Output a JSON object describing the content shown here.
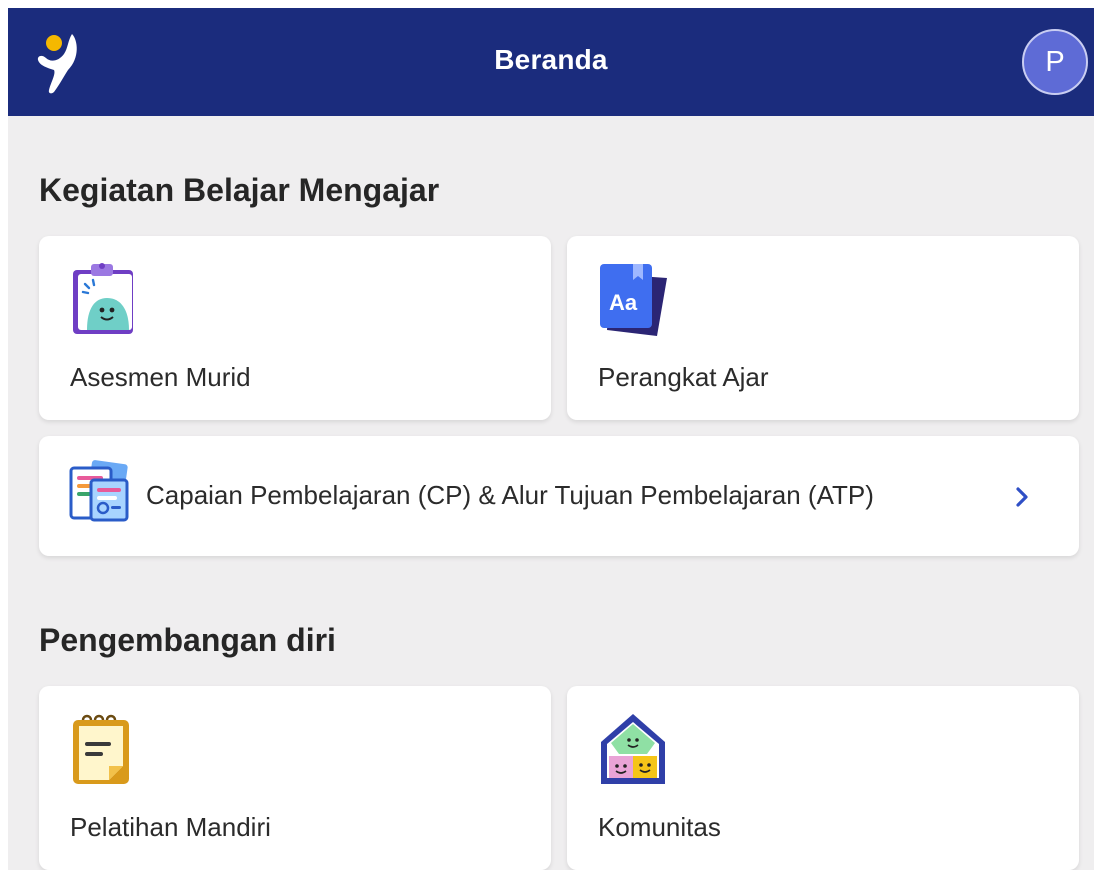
{
  "header": {
    "title": "Beranda",
    "avatar_initial": "P",
    "logo_icon": "app-logo-icon"
  },
  "sections": [
    {
      "title": "Kegiatan Belajar Mengajar",
      "cards": [
        {
          "label": "Asesmen Murid",
          "icon": "clipboard-smiley-icon"
        },
        {
          "label": "Perangkat Ajar",
          "icon": "book-aa-icon"
        },
        {
          "label": "Capaian Pembelajaran (CP) & Alur Tujuan Pembelajaran (ATP)",
          "icon": "documents-stack-icon",
          "trailing_icon": "chevron-right-icon"
        }
      ]
    },
    {
      "title": "Pengembangan diri",
      "cards": [
        {
          "label": "Pelatihan Mandiri",
          "icon": "notepad-icon"
        },
        {
          "label": "Komunitas",
          "icon": "community-house-icon"
        }
      ]
    }
  ],
  "colors": {
    "header_bg": "#1b2c7d",
    "page_bg": "#efeeef",
    "avatar_bg": "#5e6bd6",
    "chevron": "#2f4fc6"
  }
}
